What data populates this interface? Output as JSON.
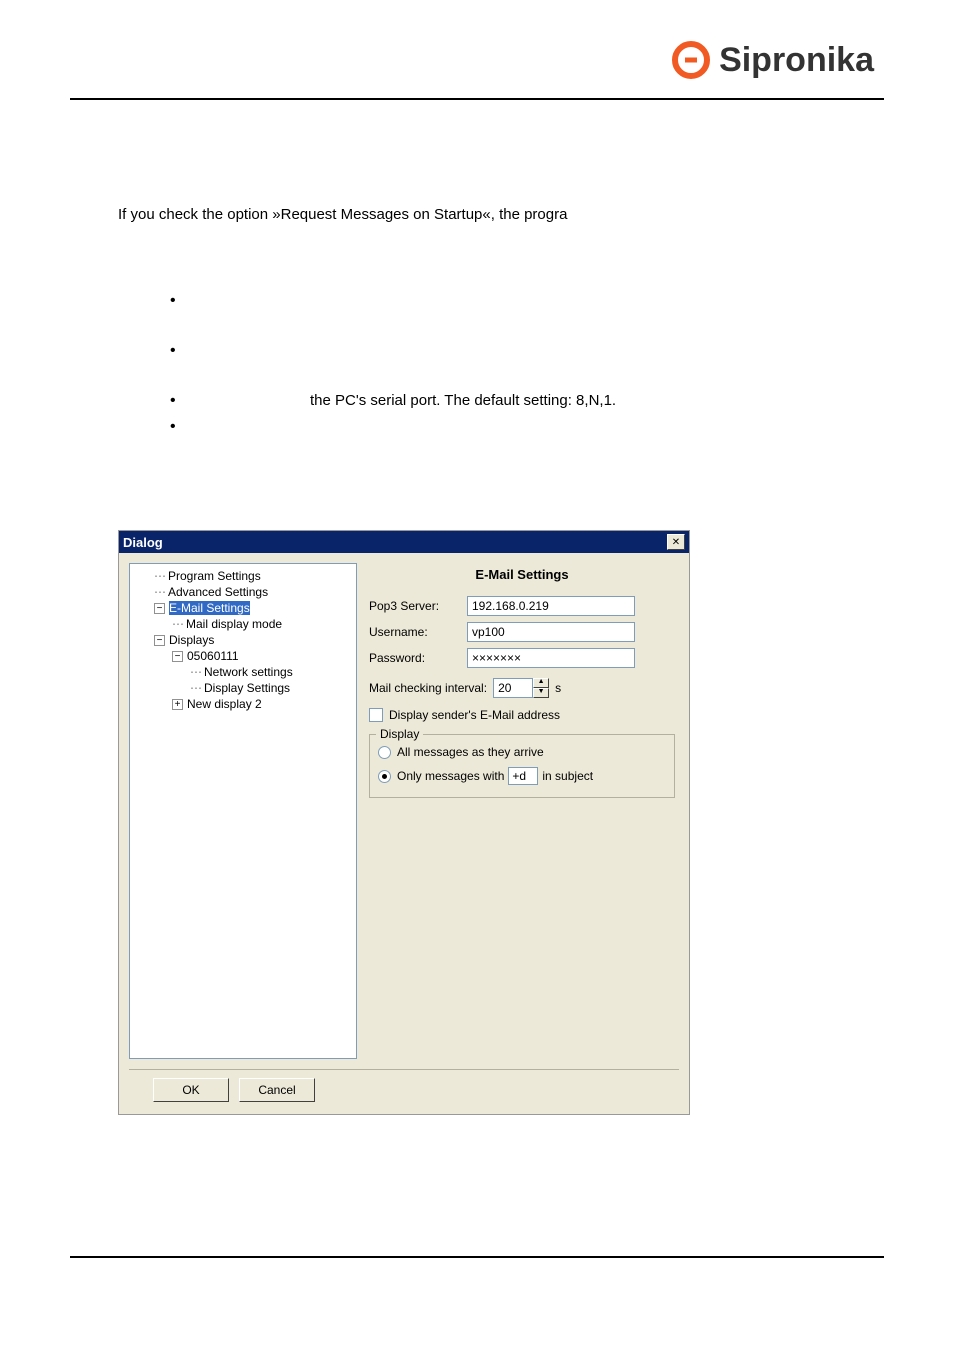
{
  "brand": "Sipronika",
  "body_text": "If you check the option »Request Messages on Startup«, the progra",
  "bullets": {
    "b3_line2": "the PC's serial port. The default setting: 8,N,1."
  },
  "dialog": {
    "title": "Dialog",
    "tree": {
      "program_settings": "Program Settings",
      "advanced_settings": "Advanced Settings",
      "email_settings": "E-Mail Settings",
      "mail_display_mode": "Mail display mode",
      "displays": "Displays",
      "display_id": "05060111",
      "network_settings": "Network settings",
      "display_settings": "Display Settings",
      "new_display_2": "New display 2"
    },
    "email_panel": {
      "title": "E-Mail Settings",
      "pop3_label": "Pop3 Server:",
      "pop3_value": "192.168.0.219",
      "user_label": "Username:",
      "user_value": "vp100",
      "pass_label": "Password:",
      "pass_value": "×××××××",
      "interval_label": "Mail checking interval:",
      "interval_value": "20",
      "interval_unit": "s",
      "show_sender": "Display sender's E-Mail address",
      "display_group": "Display",
      "all_messages": "All messages as they arrive",
      "only_prefix": "Only messages with",
      "only_tag": "+d",
      "only_suffix": "in subject"
    },
    "ok": "OK",
    "cancel": "Cancel"
  },
  "colors": {
    "brand_orange": "#f15a22",
    "titlebar": "#0a246a",
    "panel_bg": "#ece9d8"
  }
}
